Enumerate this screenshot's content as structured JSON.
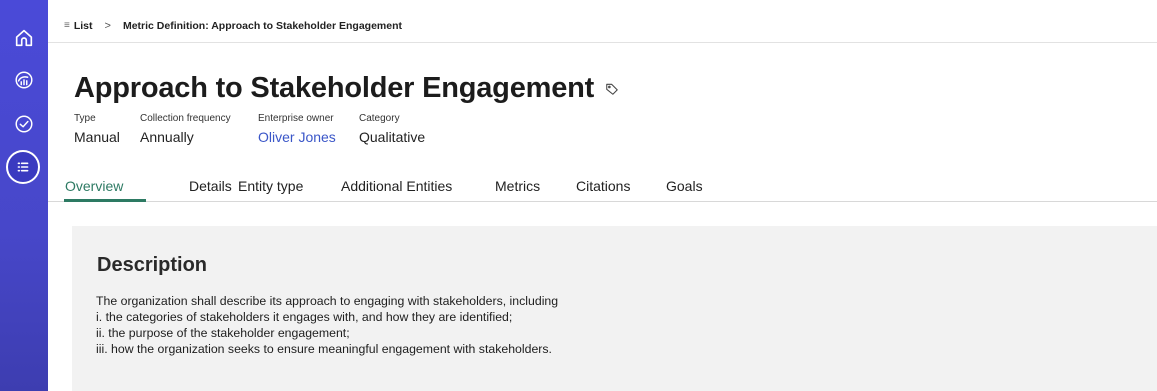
{
  "sidebar": {
    "items": [
      {
        "icon": "home-icon"
      },
      {
        "icon": "chart-globe-icon"
      },
      {
        "icon": "check-circle-icon"
      },
      {
        "icon": "list-icon",
        "active": true
      }
    ],
    "color": "#4a4ad8"
  },
  "breadcrumb": {
    "list_glyph": "≡",
    "list_label": "List",
    "separator": ">",
    "current": "Metric Definition: Approach to Stakeholder Engagement"
  },
  "header": {
    "title": "Approach to Stakeholder Engagement",
    "meta": [
      {
        "label": "Type",
        "value": "Manual"
      },
      {
        "label": "Collection frequency",
        "value": "Annually"
      },
      {
        "label": "Enterprise owner",
        "value": "Oliver Jones"
      },
      {
        "label": "Category",
        "value": "Qualitative"
      }
    ]
  },
  "tabs": [
    {
      "label": "Overview",
      "active": true
    },
    {
      "label": "Details"
    },
    {
      "label": "Entity type"
    },
    {
      "label": "Additional Entities"
    },
    {
      "label": "Metrics"
    },
    {
      "label": "Citations"
    },
    {
      "label": "Goals"
    }
  ],
  "description": {
    "heading": "Description",
    "lines": [
      "The organization shall describe its approach to engaging with stakeholders, including",
      "i. the categories of stakeholders it engages with, and how they are identified;",
      "ii. the purpose of the stakeholder engagement;",
      "iii. how the organization seeks to ensure meaningful engagement with stakeholders."
    ]
  },
  "colors": {
    "accent": "#2d7a63",
    "link": "#3a56c8",
    "panel_bg": "#f2f2f2"
  }
}
